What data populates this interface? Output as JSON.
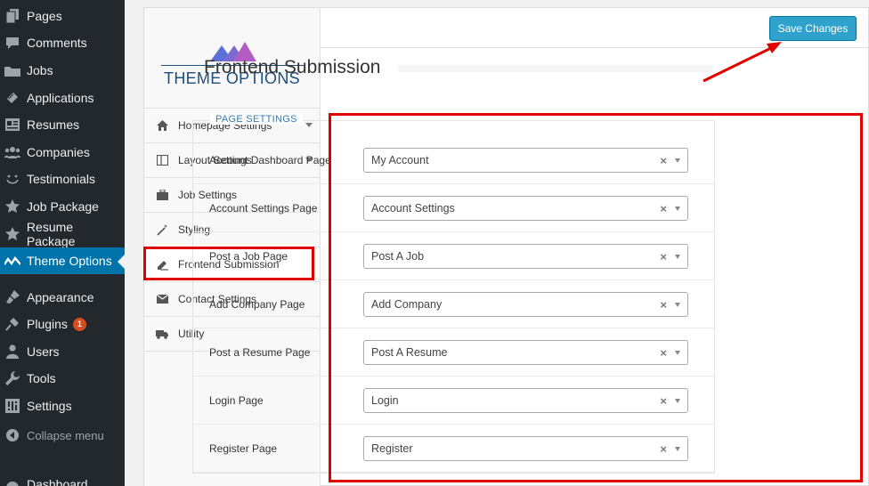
{
  "wp_menu": {
    "items": [
      {
        "label": "Pages",
        "icon": "pages-icon"
      },
      {
        "label": "Comments",
        "icon": "comments-icon"
      },
      {
        "label": "Jobs",
        "icon": "jobs-icon"
      },
      {
        "label": "Applications",
        "icon": "applications-icon"
      },
      {
        "label": "Resumes",
        "icon": "resumes-icon"
      },
      {
        "label": "Companies",
        "icon": "companies-icon"
      },
      {
        "label": "Testimonials",
        "icon": "testimonials-icon"
      },
      {
        "label": "Job Package",
        "icon": "star-icon"
      },
      {
        "label": "Resume Package",
        "icon": "star-icon"
      },
      {
        "label": "Theme Options",
        "icon": "theme-options-icon"
      },
      {
        "label": "Appearance",
        "icon": "brush-icon"
      },
      {
        "label": "Plugins",
        "icon": "plugin-icon",
        "badge": "1"
      },
      {
        "label": "Users",
        "icon": "user-icon"
      },
      {
        "label": "Tools",
        "icon": "wrench-icon"
      },
      {
        "label": "Settings",
        "icon": "settings-icon"
      },
      {
        "label": "Collapse menu",
        "icon": "collapse-icon"
      },
      {
        "label": "Dashboard",
        "icon": "dashboard-icon"
      }
    ],
    "active_color": "#0073aa",
    "badge_color": "#d54e21"
  },
  "theme_options": {
    "logo_text": "THEME OPTIONS",
    "nav": [
      {
        "label": "Homepage Settings",
        "icon": "home-icon",
        "has_submenu": true
      },
      {
        "label": "Layout Settings",
        "icon": "layout-icon",
        "has_submenu": true
      },
      {
        "label": "Job Settings",
        "icon": "briefcase-icon"
      },
      {
        "label": "Styling",
        "icon": "magic-wand-icon"
      },
      {
        "label": "Frontend Submission",
        "icon": "frontend-icon"
      },
      {
        "label": "Contact Settings",
        "icon": "envelope-icon"
      },
      {
        "label": "Utility",
        "icon": "utility-icon"
      }
    ],
    "save_label": "Save Changes",
    "section_title": "Frontend Submission",
    "legend": "PAGE SETTINGS",
    "fields": [
      {
        "label": "Account Dashboard Page",
        "value": "My Account"
      },
      {
        "label": "Account Settings Page",
        "value": "Account Settings"
      },
      {
        "label": "Post a Job Page",
        "value": "Post A Job"
      },
      {
        "label": "Add Company Page",
        "value": "Add Company"
      },
      {
        "label": "Post a Resume Page",
        "value": "Post A Resume"
      },
      {
        "label": "Login Page",
        "value": "Login"
      },
      {
        "label": "Register Page",
        "value": "Register"
      }
    ],
    "clear_glyph": "×",
    "accent_color": "#2ea2cc",
    "annotation_color": "#e00000"
  }
}
